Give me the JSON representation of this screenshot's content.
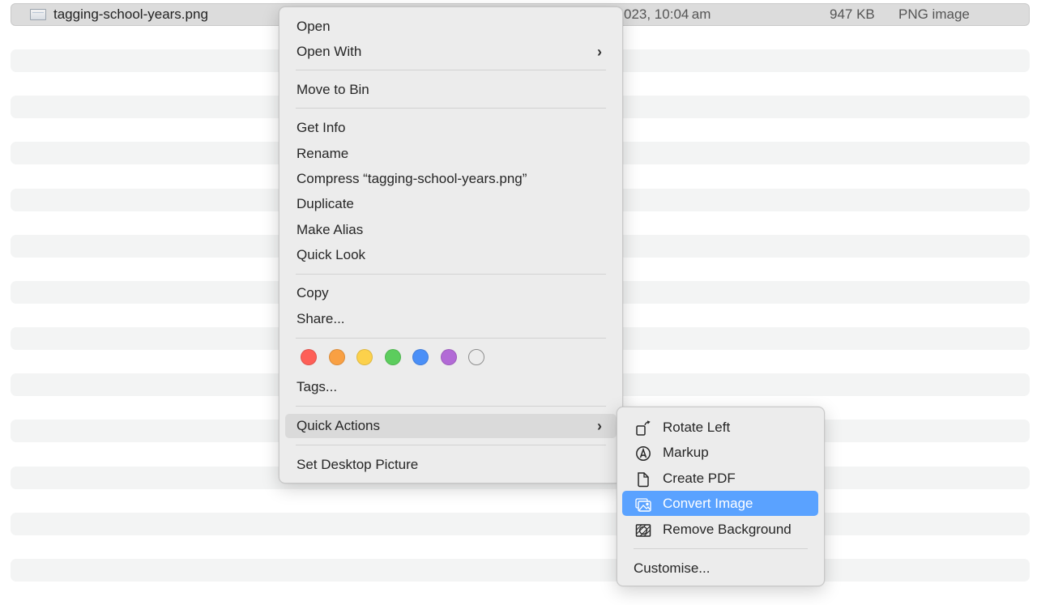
{
  "file_list": {
    "selected_file": {
      "name": "tagging-school-years.png",
      "date_modified": "023, 10:04 am",
      "size": "947 KB",
      "kind": "PNG image"
    }
  },
  "context_menu": {
    "items": [
      {
        "label": "Open"
      },
      {
        "label": "Open With",
        "submenu": true
      },
      {
        "label": "Move to Bin"
      },
      {
        "label": "Get Info"
      },
      {
        "label": "Rename"
      },
      {
        "label": "Compress “tagging-school-years.png”"
      },
      {
        "label": "Duplicate"
      },
      {
        "label": "Make Alias"
      },
      {
        "label": "Quick Look"
      },
      {
        "label": "Copy"
      },
      {
        "label": "Share..."
      },
      {
        "label": "Tags..."
      },
      {
        "label": "Quick Actions",
        "submenu": true,
        "highlighted": true
      },
      {
        "label": "Set Desktop Picture"
      }
    ],
    "chevron": "›",
    "tags": [
      {
        "name": "red",
        "color": "#fe5f57"
      },
      {
        "name": "orange",
        "color": "#f9a043"
      },
      {
        "name": "yellow",
        "color": "#fcd14b"
      },
      {
        "name": "green",
        "color": "#5ccd5d"
      },
      {
        "name": "blue",
        "color": "#4a8ff7"
      },
      {
        "name": "purple",
        "color": "#b26ad6"
      },
      {
        "name": "none",
        "color": "transparent"
      }
    ]
  },
  "quick_actions_menu": {
    "items": [
      {
        "label": "Rotate Left",
        "icon": "rotate-left-icon"
      },
      {
        "label": "Markup",
        "icon": "markup-icon"
      },
      {
        "label": "Create PDF",
        "icon": "document-icon"
      },
      {
        "label": "Convert Image",
        "icon": "photos-icon",
        "selected": true
      },
      {
        "label": "Remove Background",
        "icon": "remove-background-icon"
      }
    ],
    "customise_label": "Customise...",
    "selection_color": "#5aa2ff"
  }
}
